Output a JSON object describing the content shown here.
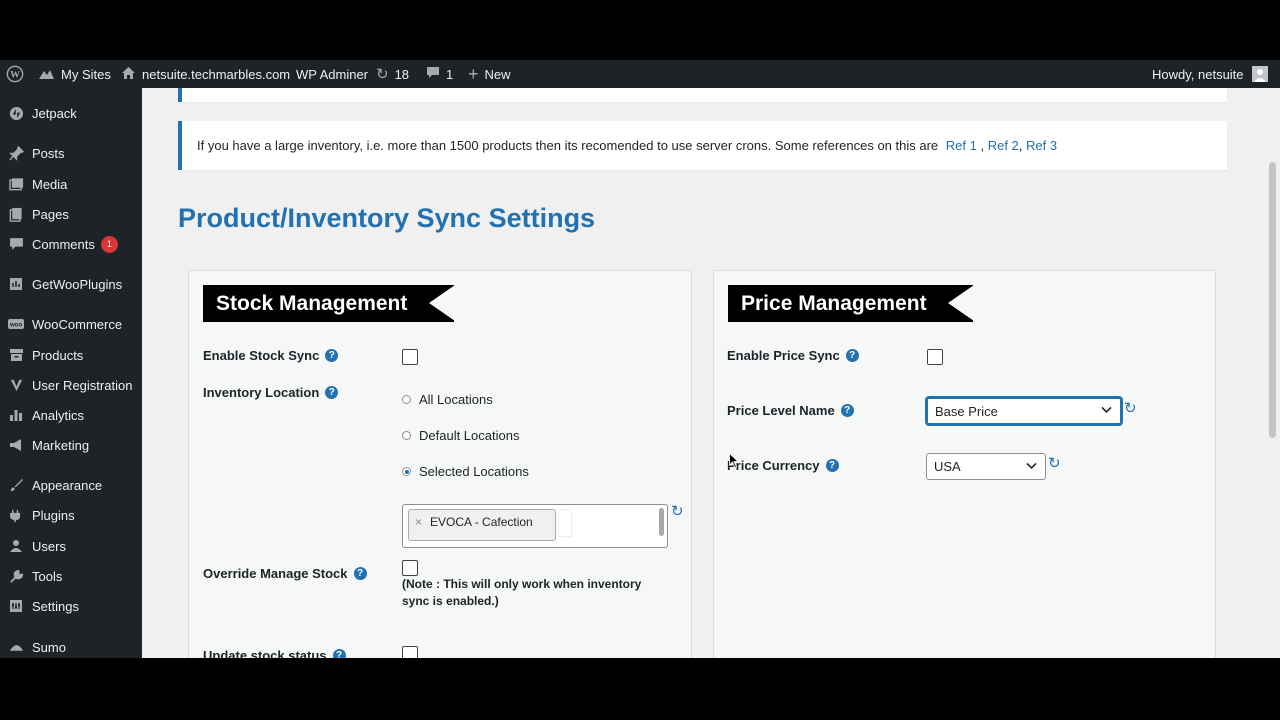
{
  "adminbar": {
    "my_sites": "My Sites",
    "site_url": "netsuite.techmarbles.com",
    "wp_adminer": "WP Adminer",
    "updates_count": "18",
    "comments_count": "1",
    "new_label": "New",
    "howdy": "Howdy, netsuite"
  },
  "sidebar": {
    "items": [
      {
        "label": "Jetpack",
        "icon": "jetpack-icon"
      },
      {
        "label": "Posts",
        "icon": "pin-icon"
      },
      {
        "label": "Media",
        "icon": "media-icon"
      },
      {
        "label": "Pages",
        "icon": "pages-icon"
      },
      {
        "label": "Comments",
        "icon": "comment-icon",
        "badge": "1"
      },
      {
        "label": "GetWooPlugins",
        "icon": "plugin-box-icon"
      },
      {
        "label": "WooCommerce",
        "icon": "woo-icon"
      },
      {
        "label": "Products",
        "icon": "archive-icon"
      },
      {
        "label": "User Registration",
        "icon": "user-reg-icon"
      },
      {
        "label": "Analytics",
        "icon": "bar-chart-icon"
      },
      {
        "label": "Marketing",
        "icon": "megaphone-icon"
      },
      {
        "label": "Appearance",
        "icon": "brush-icon"
      },
      {
        "label": "Plugins",
        "icon": "plug-icon"
      },
      {
        "label": "Users",
        "icon": "user-icon"
      },
      {
        "label": "Tools",
        "icon": "wrench-icon"
      },
      {
        "label": "Settings",
        "icon": "settings-icon"
      },
      {
        "label": "Sumo",
        "icon": "sumo-icon"
      }
    ]
  },
  "notice": {
    "text": "If you have a large inventory, i.e. more than 1500 products then its recomended to use server crons. Some references on this are",
    "ref1": "Ref 1",
    "sep1": " , ",
    "ref2": "Ref 2",
    "sep2": ", ",
    "ref3": "Ref 3"
  },
  "page_title": "Product/Inventory Sync Settings",
  "stock": {
    "heading": "Stock Management",
    "enable_stock_sync": "Enable Stock Sync",
    "inventory_location": "Inventory Location",
    "locations": [
      "All Locations",
      "Default Locations",
      "Selected Locations"
    ],
    "selected_location": "Selected Locations",
    "selected_tag": "EVOCA - Cafection",
    "override_manage_stock": "Override Manage Stock",
    "override_note": "(Note : This will only work when inventory sync is enabled.)",
    "update_stock_status": "Update stock status"
  },
  "price": {
    "heading": "Price Management",
    "enable_price_sync": "Enable Price Sync",
    "price_level_name": "Price Level Name",
    "price_level_value": "Base Price",
    "price_currency": "Price Currency",
    "price_currency_value": "USA"
  },
  "colors": {
    "accent": "#2271b1",
    "adminbar_bg": "#1d2327",
    "badge": "#d63638"
  }
}
